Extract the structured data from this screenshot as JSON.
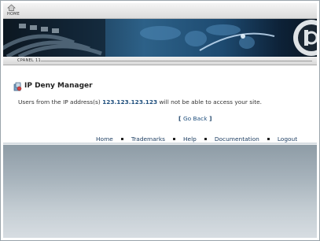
{
  "topbar": {
    "home_label": "HOME"
  },
  "cpanel": {
    "label": "CPANEL 11"
  },
  "main": {
    "title": "IP Deny Manager",
    "message_prefix": "Users from the IP address(s) ",
    "ip_address": "123.123.123.123",
    "message_suffix": " will not be able to access your site.",
    "go_back_open": "[ ",
    "go_back_label": "Go Back",
    "go_back_close": " ]"
  },
  "footer": {
    "links": [
      "Home",
      "Trademarks",
      "Help",
      "Documentation",
      "Logout"
    ]
  },
  "icons": {
    "home": "home-icon",
    "title": "ip-deny-icon"
  }
}
